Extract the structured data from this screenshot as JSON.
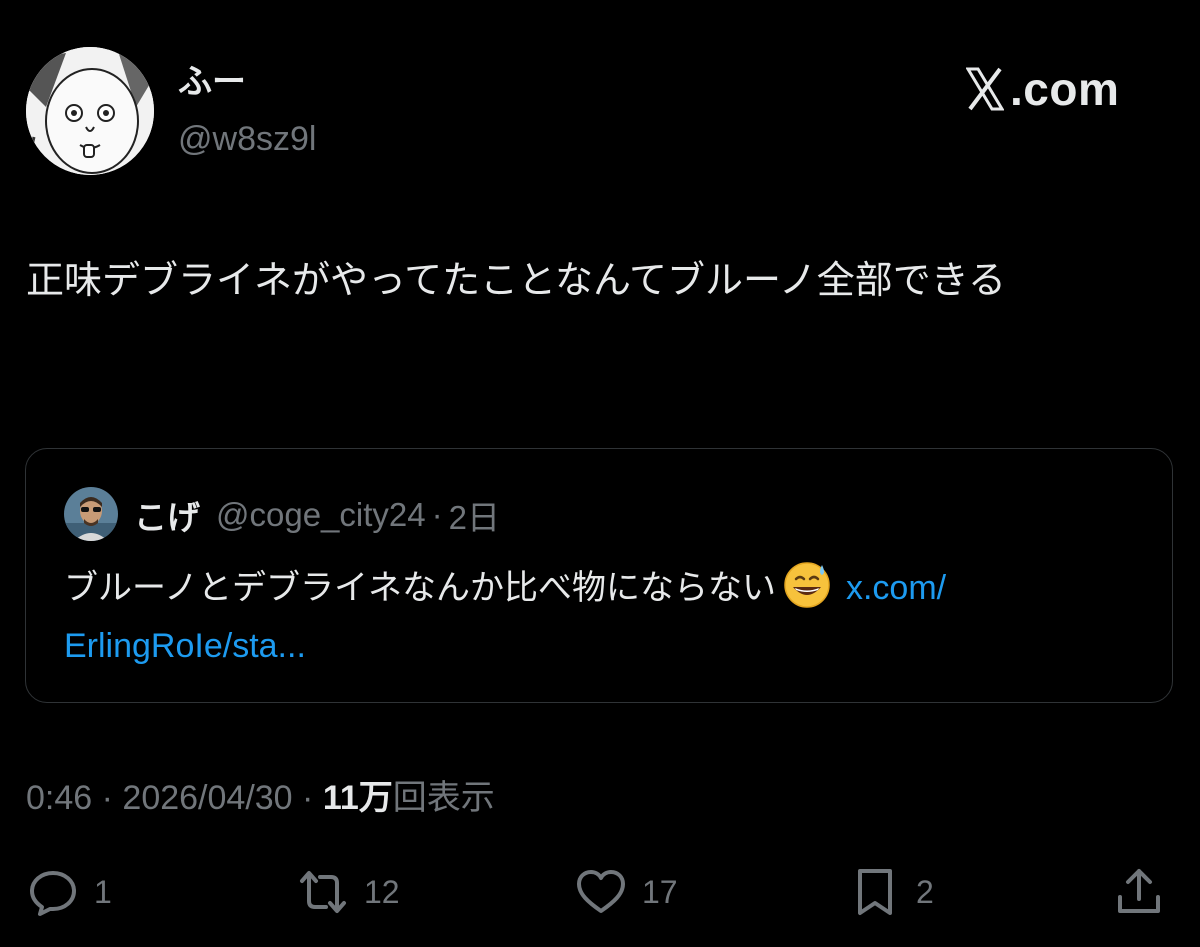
{
  "author": {
    "display_name": "ふー",
    "handle": "@w8sz9l",
    "avatar_icon": "manga-face-avatar"
  },
  "brand": {
    "text": ".com",
    "icon": "x-logo-icon"
  },
  "tweet": {
    "text": "正味デブライネがやってたことなんてブルーノ全部できる"
  },
  "quote": {
    "name": "こげ",
    "handle": "@coge_city24",
    "separator": "·",
    "time": "2日",
    "body_text": "ブルーノとデブライネなんか比べ物にならない",
    "emoji": "grinning-face-with-sweat-emoji",
    "link_text_1": "x.com/",
    "link_text_2": "ErlingRoIe/sta..."
  },
  "meta": {
    "time": "0:46",
    "separator": "·",
    "date": "2026/04/30",
    "views_count": "11万",
    "views_label": "回表示"
  },
  "actions": {
    "reply_count": "1",
    "retweet_count": "12",
    "like_count": "17",
    "bookmark_count": "2"
  },
  "colors": {
    "background": "#000000",
    "text": "#e7e9ea",
    "muted": "#71767b",
    "link": "#1d9bf0",
    "border": "#2f3336"
  }
}
